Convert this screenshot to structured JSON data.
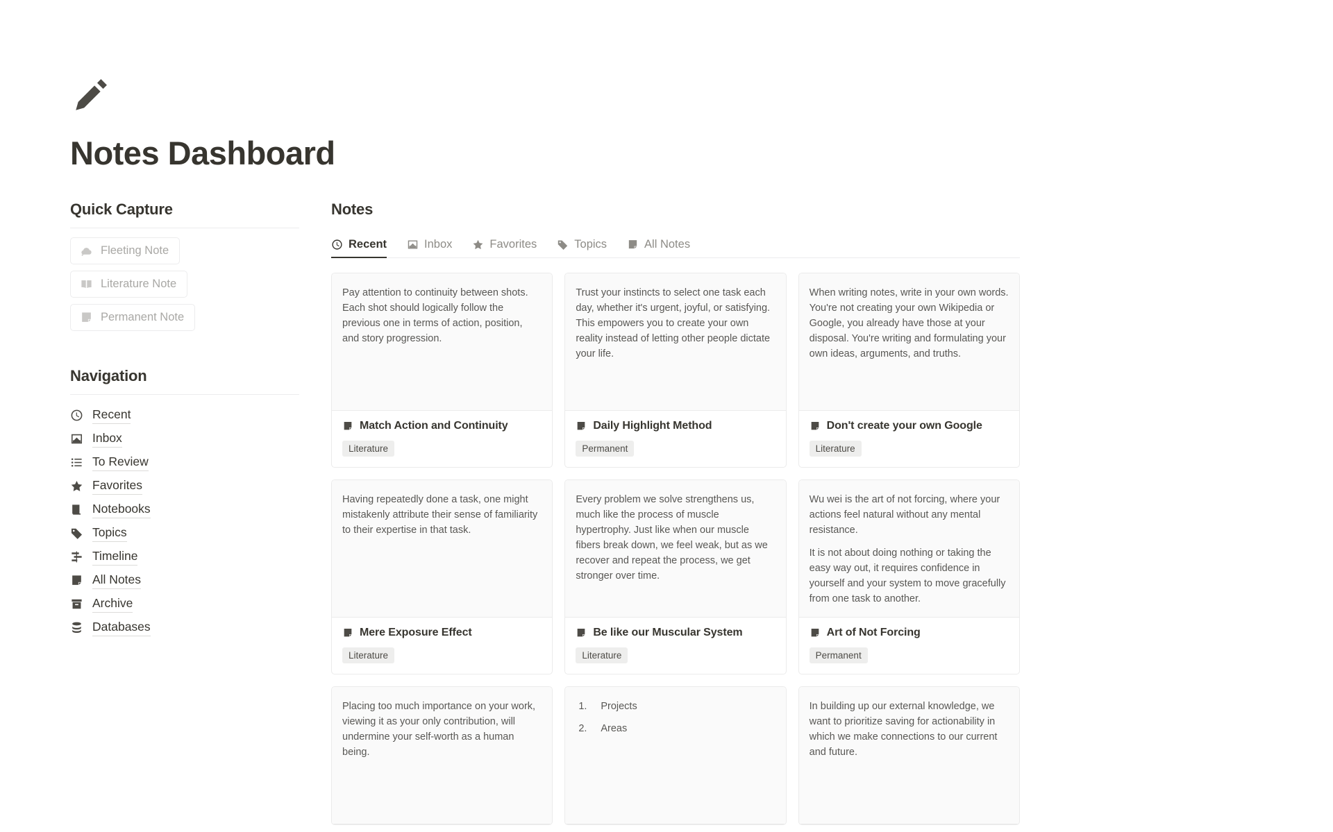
{
  "header": {
    "icon": "pencil-icon",
    "title": "Notes Dashboard"
  },
  "sidebar": {
    "quick_capture": {
      "title": "Quick Capture",
      "buttons": [
        {
          "label": "Fleeting Note",
          "icon": "cloud-icon"
        },
        {
          "label": "Literature Note",
          "icon": "open-book-icon"
        },
        {
          "label": "Permanent Note",
          "icon": "note-icon"
        }
      ]
    },
    "navigation": {
      "title": "Navigation",
      "items": [
        {
          "label": "Recent",
          "icon": "clock-icon"
        },
        {
          "label": "Inbox",
          "icon": "inbox-tray-icon"
        },
        {
          "label": "To Review",
          "icon": "list-icon"
        },
        {
          "label": "Favorites",
          "icon": "star-icon"
        },
        {
          "label": "Notebooks",
          "icon": "book-icon"
        },
        {
          "label": "Topics",
          "icon": "tag-icon"
        },
        {
          "label": "Timeline",
          "icon": "timeline-icon"
        },
        {
          "label": "All Notes",
          "icon": "note-icon"
        },
        {
          "label": "Archive",
          "icon": "archive-box-icon"
        },
        {
          "label": "Databases",
          "icon": "database-icon"
        }
      ]
    }
  },
  "main": {
    "title": "Notes",
    "tabs": [
      {
        "label": "Recent",
        "icon": "clock-icon",
        "active": true
      },
      {
        "label": "Inbox",
        "icon": "inbox-tray-icon",
        "active": false
      },
      {
        "label": "Favorites",
        "icon": "star-icon",
        "active": false
      },
      {
        "label": "Topics",
        "icon": "tag-icon",
        "active": false
      },
      {
        "label": "All Notes",
        "icon": "note-icon",
        "active": false
      }
    ],
    "cards": [
      {
        "preview": [
          "Pay attention to continuity between shots. Each shot should logically follow the previous one in terms of action, position, and story progression."
        ],
        "title": "Match Action and Continuity",
        "tag": "Literature",
        "icon": "note-icon"
      },
      {
        "preview": [
          "Trust your instincts to select one task each day, whether it's urgent, joyful, or satisfying. This empowers you to create your own reality instead of letting other people dictate your life."
        ],
        "title": "Daily Highlight Method",
        "tag": "Permanent",
        "icon": "note-icon"
      },
      {
        "preview": [
          "When writing notes, write in your own words. You're not creating your own Wikipedia or Google, you already have those at your disposal. You're writing and formulating your own ideas, arguments, and truths."
        ],
        "title": "Don't create your own Google",
        "tag": "Literature",
        "icon": "note-icon"
      },
      {
        "preview": [
          "Having repeatedly done a task, one might mistakenly attribute their sense of familiarity to their expertise in that task."
        ],
        "title": "Mere Exposure Effect",
        "tag": "Literature",
        "icon": "note-icon"
      },
      {
        "preview": [
          "Every problem we solve strengthens us, much like the process of muscle hypertrophy. Just like when our muscle fibers break down, we feel weak, but as we recover and repeat the process, we get stronger over time."
        ],
        "title": "Be like our Muscular System",
        "tag": "Literature",
        "icon": "note-icon"
      },
      {
        "preview": [
          "Wu wei is the art of not forcing, where your actions feel natural without any mental resistance.",
          "It is not about doing nothing or taking the easy way out, it requires confidence in yourself and your system to move gracefully from one task to another."
        ],
        "title": "Art of Not Forcing",
        "tag": "Permanent",
        "icon": "note-icon"
      },
      {
        "preview": [
          "Placing too much importance on your work, viewing it as your only contribution, will undermine your self-worth as a human being."
        ],
        "title": "",
        "tag": "",
        "icon": "note-icon"
      },
      {
        "preview_list": [
          "Projects",
          "Areas"
        ],
        "title": "",
        "tag": "",
        "icon": "note-icon"
      },
      {
        "preview": [
          "In building up our external knowledge, we want to prioritize saving for actionability in which we make connections to our current and future."
        ],
        "title": "",
        "tag": "",
        "icon": "note-icon"
      }
    ]
  }
}
